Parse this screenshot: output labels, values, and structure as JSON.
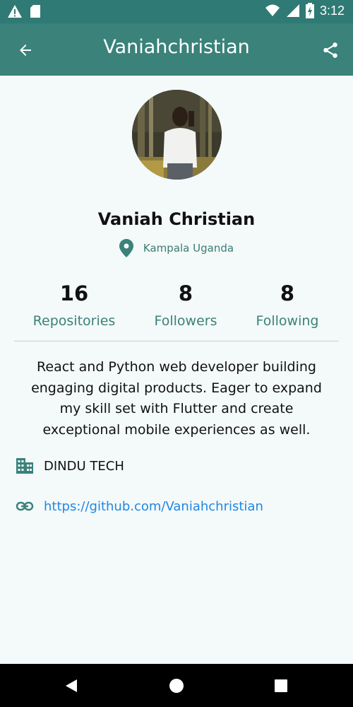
{
  "status_bar": {
    "time": "3:12",
    "icons": [
      "warning-icon",
      "sd-card-icon",
      "wifi-icon",
      "signal-icon",
      "battery-charging-icon"
    ]
  },
  "app_bar": {
    "title": "Vaniahchristian",
    "back_icon": "arrow-back-icon",
    "share_icon": "share-icon"
  },
  "profile": {
    "name": "Vaniah Christian",
    "location": "Kampala Uganda",
    "stats": [
      {
        "value": "16",
        "label": "Repositories"
      },
      {
        "value": "8",
        "label": "Followers"
      },
      {
        "value": "8",
        "label": "Following"
      }
    ],
    "bio": "React and Python web developer building engaging digital products. Eager to expand my skill set with Flutter and create exceptional mobile experiences as well.",
    "company": "DINDU TECH",
    "link": "https://github.com/Vaniahchristian"
  },
  "colors": {
    "primary": "#3a827a",
    "status_bar": "#2f7a74",
    "background": "#f4f9f9",
    "link": "#1e88e5"
  },
  "nav_bar": {
    "icons": [
      "back-triangle-icon",
      "home-circle-icon",
      "recents-square-icon"
    ]
  }
}
